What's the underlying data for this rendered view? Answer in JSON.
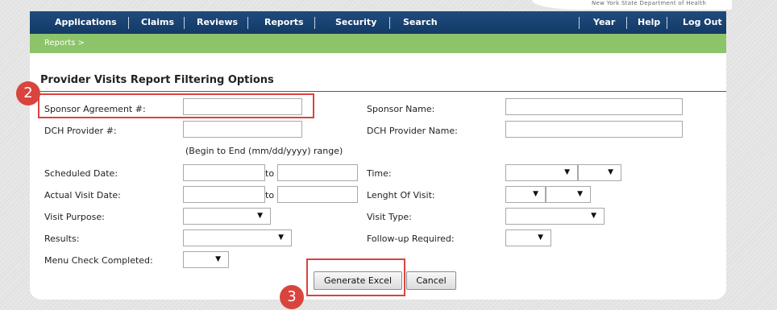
{
  "header": {
    "department": "New York State Department of Health"
  },
  "nav": {
    "left": [
      "Applications",
      "Claims",
      "Reviews",
      "Reports",
      "Security",
      "Search"
    ],
    "right": [
      "Year",
      "Help",
      "Log Out"
    ]
  },
  "breadcrumb": "Reports >",
  "form": {
    "title": "Provider Visits Report Filtering Options",
    "labels": {
      "sponsor_agreement": "Sponsor Agreement #:",
      "sponsor_name": "Sponsor Name:",
      "dch_provider": "DCH Provider #:",
      "dch_provider_name": "DCH Provider Name:",
      "date_range_hint": "(Begin to End (mm/dd/yyyy) range)",
      "scheduled_date": "Scheduled Date:",
      "actual_visit_date": "Actual Visit Date:",
      "to": "to",
      "time": "Time:",
      "length_of_visit": "Lenght Of Visit:",
      "visit_purpose": "Visit Purpose:",
      "visit_type": "Visit Type:",
      "results": "Results:",
      "follow_up_required": "Follow-up Required:",
      "menu_check_completed": "Menu Check Completed:"
    },
    "values": {
      "sponsor_agreement": "",
      "sponsor_name": "",
      "dch_provider": "",
      "dch_provider_name": "",
      "scheduled_from": "",
      "scheduled_to": "",
      "actual_from": "",
      "actual_to": ""
    }
  },
  "buttons": {
    "generate_excel": "Generate Excel",
    "cancel": "Cancel"
  },
  "annotations": {
    "step2": "2",
    "step3": "3"
  },
  "icons": {
    "dropdown_arrow": "▼"
  },
  "colors": {
    "nav_bg": "#1f4b7e",
    "breadcrumb_bg": "#8dc46a",
    "highlight": "#d9443d"
  }
}
